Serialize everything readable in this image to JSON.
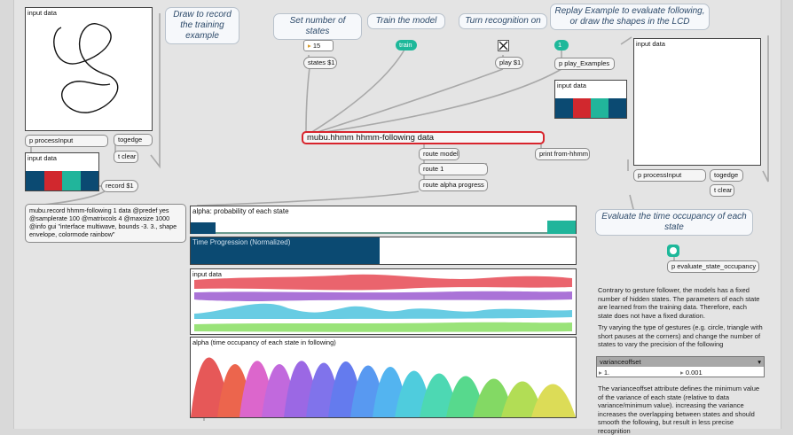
{
  "comments": {
    "draw_record": "Draw to record the training example",
    "set_states": "Set number of states",
    "train_model": "Train the model",
    "turn_recognition": "Turn recognition on",
    "replay": "Replay Example to evaluate following, or draw the shapes in the LCD",
    "evaluate": "Evaluate the time occupancy of each state"
  },
  "objects": {
    "states_number": "15",
    "states_msg": "states $1",
    "train": "train",
    "play_msg": "play $1",
    "replay_number": "1",
    "play_examples": "p play_Examples",
    "process_input_left": "p processInput",
    "togedge_left": "togedge",
    "tclear_left": "t clear",
    "record_msg": "record $1",
    "mubu_record": "mubu.record hhmm-following 1 data @predef yes @samplerate 100 @matrixcols 4 @maxsize 1000 @info gui \"interface multiwave, bounds -3. 3., shape envelope, colormode rainbow\"",
    "mubu_hhmm": "mubu.hhmm hhmm-following data",
    "route_model": "route model",
    "print": "print from-hhmm",
    "route_1": "route 1",
    "route_alpha": "route alpha progress",
    "process_input_right": "p processInput",
    "togedge_right": "togedge",
    "tclear_right": "t clear",
    "evaluate_obj": "p evaluate_state_occupancy"
  },
  "panels": {
    "lcd_left_title": "input data",
    "input_data_left_title": "input data",
    "input_data_replay_title": "input data",
    "lcd_right_title": "input data",
    "alpha_title": "alpha: probability of each state",
    "progression_title": "Time Progression (Normalized)",
    "multiwave_title": "input data",
    "occupancy_title": "alpha (time occupancy of each state in following)"
  },
  "progress": {
    "time_progression": 0.49
  },
  "text": {
    "para1": "Contrary to gesture follower, the models has a fixed number of hidden states. The parameters of each state are learned from the training data. Therefore, each state does not have a fixed duration.",
    "para2": "Try varying the type of gestures (e.g. circle, triangle with short pauses at the corners) and change the number of states to vary the precision of the following",
    "para3": "The varianceoffset attribute defines the minimum value of the variance of each state (relative to data variance/minimum value). increasing the variance increases the overlapping between states and should smooth the following, but result in less precise recognition"
  },
  "attribute": {
    "name": "varianceoffset",
    "value1": "1.",
    "value2": "0.001"
  },
  "colors": {
    "navy": "#0b4a72",
    "red": "#d1282e",
    "teal": "#21b59b",
    "highlight": "#d8242c",
    "msg_teal": "#1eb89a",
    "comment_blue": "#2d4a6a"
  }
}
